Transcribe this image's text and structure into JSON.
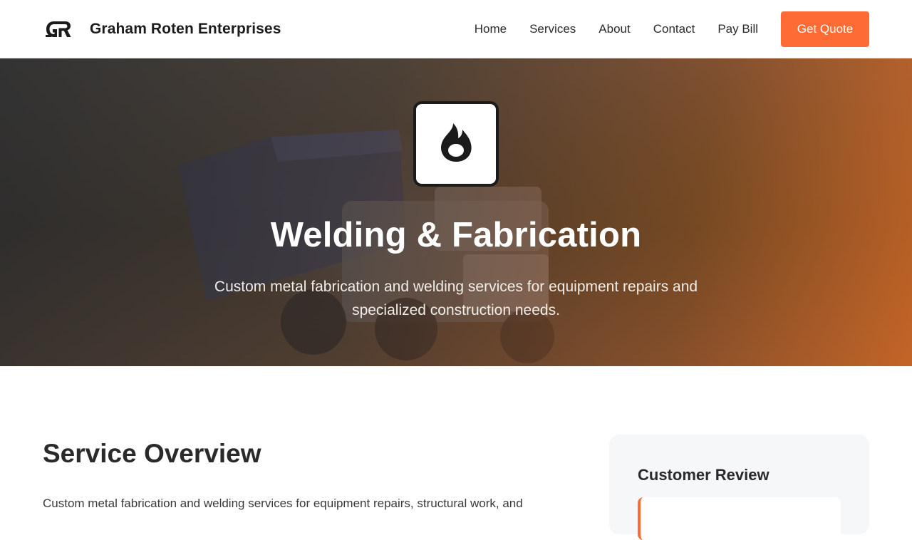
{
  "header": {
    "brand_name": "Graham Roten Enterprises",
    "logo_icon": "gr-monogram-icon",
    "nav": [
      {
        "label": "Home"
      },
      {
        "label": "Services"
      },
      {
        "label": "About"
      },
      {
        "label": "Contact"
      },
      {
        "label": "Pay Bill"
      }
    ],
    "cta_label": "Get Quote"
  },
  "hero": {
    "icon": "flame-icon",
    "title": "Welding & Fabrication",
    "subtitle": "Custom metal fabrication and welding services for equipment repairs and specialized construction needs."
  },
  "overview": {
    "title": "Service Overview",
    "text": "Custom metal fabrication and welding services for equipment repairs, structural work, and"
  },
  "review": {
    "title": "Customer Review"
  },
  "colors": {
    "accent": "#ff6b35",
    "text_dark": "#2a2a2a",
    "card_bg": "#f6f7f9"
  }
}
